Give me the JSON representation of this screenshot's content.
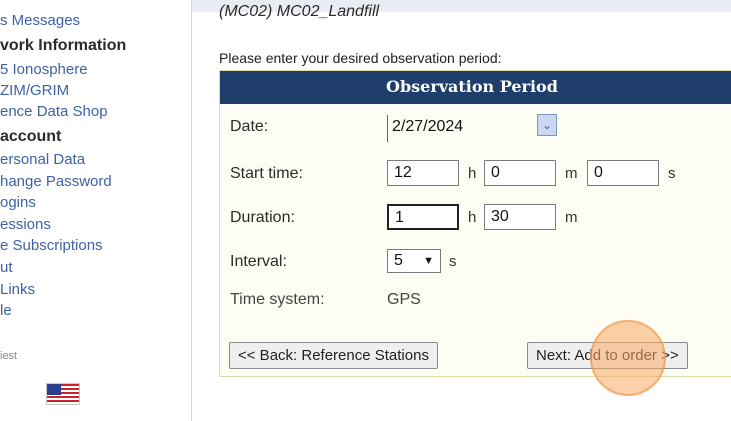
{
  "sidebar": {
    "lines": [
      {
        "text": "s Messages",
        "kind": "link"
      },
      {
        "text": "vork Information",
        "kind": "header"
      },
      {
        "text": "5 Ionosphere",
        "kind": "link"
      },
      {
        "text": "ZIM/GRIM",
        "kind": "link"
      },
      {
        "text": "ence Data Shop",
        "kind": "link"
      },
      {
        "text": "account",
        "kind": "header"
      },
      {
        "text": "ersonal Data",
        "kind": "link"
      },
      {
        "text": "hange Password",
        "kind": "link"
      },
      {
        "text": "ogins",
        "kind": "link"
      },
      {
        "text": "essions",
        "kind": "link"
      },
      {
        "text": "e Subscriptions",
        "kind": "link"
      },
      {
        "text": "ut",
        "kind": "link"
      },
      {
        "text": "Links",
        "kind": "link"
      },
      {
        "text": "le",
        "kind": "link"
      },
      {
        "text": "iest",
        "kind": "guest"
      }
    ],
    "flag_icon": "us-flag-icon"
  },
  "page": {
    "heading": "(MC02) MC02_Landfill",
    "prompt": "Please enter your desired observation period:"
  },
  "panel": {
    "title": "Observation Period",
    "date": {
      "label": "Date:",
      "value": "2/27/2024",
      "dropdown_icon": "chevron-down-icon"
    },
    "start_time": {
      "label": "Start time:",
      "hours": "12",
      "minutes": "0",
      "seconds": "0",
      "h_unit": "h",
      "m_unit": "m",
      "s_unit": "s"
    },
    "duration": {
      "label": "Duration:",
      "hours": "1",
      "minutes": "30",
      "h_unit": "h",
      "m_unit": "m"
    },
    "interval": {
      "label": "Interval:",
      "value": "5",
      "unit": "s"
    },
    "time_system": {
      "label": "Time system:",
      "value": "GPS"
    },
    "back_button": "<< Back: Reference Stations",
    "next_button": "Next: Add to order >>"
  },
  "colors": {
    "panel_header": "#1f3e6b",
    "sidebar_link": "#3f62a6",
    "highlight": "#f7aa64"
  }
}
